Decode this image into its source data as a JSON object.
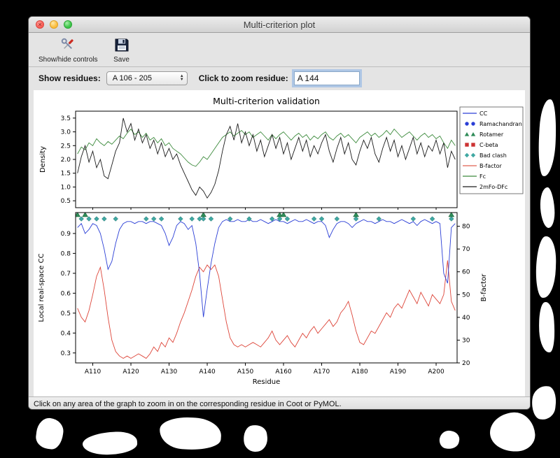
{
  "window": {
    "title": "Multi-criterion plot"
  },
  "toolbar": {
    "show_hide_label": "Show/hide controls",
    "save_label": "Save"
  },
  "controls": {
    "show_residues_label": "Show residues:",
    "residue_range_value": "A 106 - 205",
    "zoom_label": "Click to zoom residue:",
    "zoom_value": "A 144"
  },
  "status_bar": {
    "text": "Click on any area of the graph to zoom in on the corresponding residue in Coot or PyMOL."
  },
  "chart_data": {
    "type": "line",
    "title": "Multi-criterion validation",
    "xlabel": "Residue",
    "x_start": 106,
    "x_end": 205,
    "x_tick_positions": [
      110,
      120,
      130,
      140,
      150,
      160,
      170,
      180,
      190,
      200
    ],
    "x_ticks": [
      "A110",
      "A120",
      "A130",
      "A140",
      "A150",
      "A160",
      "A170",
      "A180",
      "A190",
      "A200"
    ],
    "top_plot": {
      "ylabel": "Density",
      "ylim": [
        0.25,
        3.75
      ],
      "yticks": [
        0.5,
        1.0,
        1.5,
        2.0,
        2.5,
        3.0,
        3.5
      ],
      "series": [
        {
          "name": "Fc",
          "color": "#3d8b3d",
          "values": [
            2.2,
            2.45,
            2.35,
            2.6,
            2.5,
            2.75,
            2.6,
            2.5,
            2.65,
            2.55,
            2.7,
            2.85,
            2.75,
            2.95,
            3.1,
            2.9,
            3.0,
            2.8,
            2.95,
            2.7,
            2.8,
            2.6,
            2.75,
            2.5,
            2.6,
            2.4,
            2.3,
            2.2,
            2.05,
            1.9,
            1.8,
            1.75,
            1.9,
            2.1,
            2.0,
            2.2,
            2.4,
            2.6,
            2.8,
            2.9,
            3.0,
            2.85,
            2.95,
            3.05,
            2.9,
            3.0,
            2.8,
            2.9,
            3.0,
            2.85,
            2.7,
            2.9,
            2.75,
            2.9,
            3.0,
            2.85,
            2.7,
            2.85,
            2.95,
            2.8,
            2.9,
            2.7,
            2.85,
            2.75,
            2.9,
            3.0,
            2.8,
            2.7,
            2.85,
            2.95,
            2.8,
            2.9,
            2.75,
            2.6,
            2.8,
            2.9,
            3.0,
            2.85,
            2.95,
            2.8,
            2.9,
            3.05,
            2.9,
            3.1,
            2.95,
            2.8,
            2.9,
            3.0,
            2.85,
            2.7,
            2.85,
            2.95,
            2.8,
            2.9,
            2.75,
            2.85,
            2.6,
            2.4,
            2.7,
            2.5
          ]
        },
        {
          "name": "2mFo-DFc",
          "color": "#1a1a1a",
          "values": [
            1.5,
            2.1,
            2.5,
            1.9,
            2.3,
            1.7,
            2.0,
            1.4,
            1.3,
            1.8,
            2.3,
            2.6,
            3.5,
            3.0,
            3.3,
            2.7,
            3.1,
            2.6,
            2.9,
            2.4,
            2.7,
            2.2,
            2.6,
            2.1,
            2.4,
            2.0,
            2.2,
            1.8,
            1.5,
            1.2,
            0.9,
            0.7,
            1.0,
            0.85,
            0.6,
            0.8,
            1.1,
            1.6,
            2.3,
            2.9,
            3.2,
            2.7,
            3.3,
            2.6,
            3.0,
            2.5,
            2.9,
            2.3,
            2.7,
            2.1,
            2.5,
            2.9,
            2.4,
            2.8,
            2.2,
            2.6,
            2.0,
            2.4,
            2.8,
            2.3,
            2.7,
            2.1,
            2.5,
            2.2,
            2.6,
            2.9,
            2.3,
            1.9,
            2.4,
            2.8,
            2.2,
            2.6,
            2.0,
            1.8,
            2.3,
            2.7,
            2.4,
            2.8,
            2.2,
            1.9,
            2.4,
            2.8,
            2.3,
            2.7,
            2.1,
            2.5,
            2.0,
            2.4,
            2.8,
            2.2,
            2.6,
            2.1,
            2.5,
            2.3,
            2.7,
            2.2,
            2.6,
            1.7,
            2.3,
            2.0
          ]
        }
      ]
    },
    "bottom_plot": {
      "left_ylabel": "Local real-space CC",
      "left_ylim": [
        0.25,
        1.005
      ],
      "left_yticks": [
        0.3,
        0.4,
        0.5,
        0.6,
        0.7,
        0.8,
        0.9
      ],
      "right_ylabel": "B-factor",
      "right_ylim": [
        20,
        86
      ],
      "right_yticks": [
        20,
        30,
        40,
        50,
        60,
        70,
        80
      ],
      "cc": {
        "name": "CC",
        "color": "#2b3fd6",
        "values": [
          0.93,
          0.95,
          0.9,
          0.92,
          0.95,
          0.94,
          0.9,
          0.82,
          0.72,
          0.76,
          0.85,
          0.92,
          0.95,
          0.96,
          0.96,
          0.95,
          0.96,
          0.96,
          0.95,
          0.96,
          0.96,
          0.95,
          0.94,
          0.9,
          0.84,
          0.88,
          0.94,
          0.96,
          0.95,
          0.92,
          0.94,
          0.85,
          0.7,
          0.48,
          0.62,
          0.75,
          0.85,
          0.93,
          0.96,
          0.97,
          0.96,
          0.96,
          0.97,
          0.96,
          0.96,
          0.97,
          0.96,
          0.96,
          0.97,
          0.96,
          0.95,
          0.96,
          0.97,
          0.96,
          0.96,
          0.95,
          0.96,
          0.97,
          0.96,
          0.96,
          0.97,
          0.96,
          0.95,
          0.96,
          0.96,
          0.94,
          0.88,
          0.92,
          0.95,
          0.96,
          0.96,
          0.95,
          0.93,
          0.95,
          0.96,
          0.97,
          0.96,
          0.96,
          0.95,
          0.96,
          0.97,
          0.96,
          0.96,
          0.95,
          0.96,
          0.97,
          0.96,
          0.95,
          0.96,
          0.94,
          0.96,
          0.97,
          0.96,
          0.95,
          0.96,
          0.95,
          0.7,
          0.65,
          0.93,
          0.95
        ]
      },
      "bfactor": {
        "name": "B-factor",
        "color": "#dd4438",
        "values": [
          44,
          40,
          38,
          43,
          50,
          58,
          62,
          52,
          40,
          30,
          25,
          23,
          22,
          23,
          22,
          23,
          24,
          23,
          22,
          24,
          27,
          25,
          29,
          27,
          31,
          29,
          33,
          38,
          42,
          47,
          52,
          58,
          62,
          60,
          63,
          61,
          63,
          58,
          48,
          38,
          31,
          28,
          27,
          28,
          27,
          28,
          29,
          28,
          27,
          29,
          31,
          34,
          30,
          28,
          30,
          32,
          29,
          27,
          30,
          33,
          31,
          34,
          36,
          33,
          35,
          37,
          39,
          36,
          38,
          42,
          44,
          47,
          41,
          34,
          29,
          28,
          31,
          34,
          33,
          36,
          39,
          42,
          40,
          44,
          46,
          44,
          48,
          52,
          49,
          46,
          51,
          48,
          45,
          50,
          48,
          46,
          50,
          65,
          47,
          43
        ]
      },
      "markers": {
        "bad_clash": {
          "name": "Bad clash",
          "color": "#3fa8a2",
          "residues": [
            107,
            109,
            111,
            113,
            116,
            124,
            126,
            128,
            133,
            136,
            138,
            139,
            141,
            146,
            151,
            157,
            159,
            161,
            168,
            170,
            174,
            179,
            185,
            194,
            199,
            204
          ]
        },
        "rotamer": {
          "name": "Rotamer",
          "color": "#2e8b57",
          "residues": [
            106,
            108,
            139,
            159,
            160,
            179,
            204
          ]
        }
      }
    },
    "legend": [
      {
        "label": "CC",
        "type": "line",
        "color": "#2b3fd6"
      },
      {
        "label": "Ramachandran",
        "type": "circles",
        "color": "#2b3fd6"
      },
      {
        "label": "Rotamer",
        "type": "triangles",
        "color": "#2e8b57"
      },
      {
        "label": "C-beta",
        "type": "squares",
        "color": "#cc3333"
      },
      {
        "label": "Bad clash",
        "type": "diamonds",
        "color": "#3fa8a2"
      },
      {
        "label": "B-factor",
        "type": "line",
        "color": "#e06050"
      },
      {
        "label": "Fc",
        "type": "line",
        "color": "#3d8b3d"
      },
      {
        "label": "2mFo-DFc",
        "type": "line",
        "color": "#1a1a1a"
      }
    ]
  }
}
